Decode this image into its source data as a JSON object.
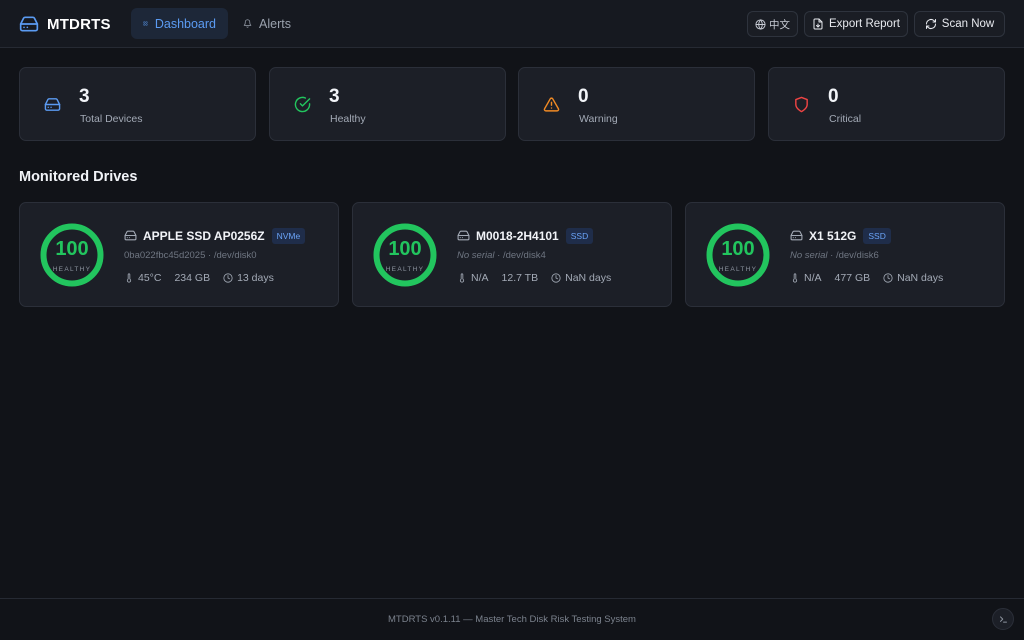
{
  "app": {
    "name": "MTDRTS"
  },
  "nav": {
    "tabs": [
      {
        "label": "Dashboard",
        "icon": "grid-icon",
        "active": true
      },
      {
        "label": "Alerts",
        "icon": "bell-icon",
        "active": false
      }
    ]
  },
  "toolbar": {
    "language_label": "中文",
    "export_label": "Export Report",
    "scan_label": "Scan Now"
  },
  "stats": [
    {
      "value": "3",
      "label": "Total Devices",
      "icon": "drive-icon",
      "color": "#5b9bf2"
    },
    {
      "value": "3",
      "label": "Healthy",
      "icon": "check-circle-icon",
      "color": "#22c55e"
    },
    {
      "value": "0",
      "label": "Warning",
      "icon": "warning-triangle-icon",
      "color": "#f08a24"
    },
    {
      "value": "0",
      "label": "Critical",
      "icon": "shield-icon",
      "color": "#ef4444"
    }
  ],
  "section": {
    "title": "Monitored Drives"
  },
  "drives": [
    {
      "health": "100",
      "health_label": "HEALTHY",
      "name": "APPLE SSD AP0256Z",
      "type": "NVMe",
      "serial": "0ba022fbc45d2025",
      "path": "/dev/disk0",
      "temperature": "45°C",
      "capacity": "234 GB",
      "age": "13 days"
    },
    {
      "health": "100",
      "health_label": "HEALTHY",
      "name": "M0018-2H4101",
      "type": "SSD",
      "serial": "No serial",
      "path": "/dev/disk4",
      "temperature": "N/A",
      "capacity": "12.7 TB",
      "age": "NaN days"
    },
    {
      "health": "100",
      "health_label": "HEALTHY",
      "name": "X1 512G",
      "type": "SSD",
      "serial": "No serial",
      "path": "/dev/disk6",
      "temperature": "N/A",
      "capacity": "477 GB",
      "age": "NaN days"
    }
  ],
  "footer": {
    "text": "MTDRTS v0.1.11 — Master Tech Disk Risk Testing System"
  },
  "colors": {
    "accent": "#5b9bf2",
    "healthy": "#22c55e",
    "warning": "#f08a24",
    "critical": "#ef4444",
    "background": "#111318",
    "card": "#1c1f27"
  }
}
